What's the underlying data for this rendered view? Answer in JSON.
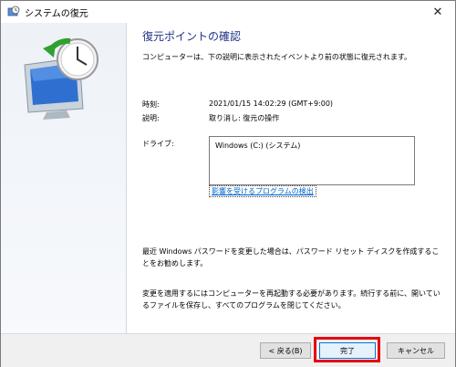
{
  "window": {
    "title": "システムの復元",
    "close_glyph": "✕"
  },
  "content": {
    "heading": "復元ポイントの確認",
    "intro": "コンピューターは、下の説明に表示されたイベントより前の状態に復元されます。",
    "time_label": "時刻:",
    "time_value": "2021/01/15 14:02:29 (GMT+9:00)",
    "desc_label": "説明:",
    "desc_value": "取り消し: 復元の操作",
    "drive_label": "ドライブ:",
    "drives": [
      "Windows (C:) (システム)"
    ],
    "link_affected": "影響を受けるプログラムの検出",
    "note_password": "最近 Windows パスワードを変更した場合は、パスワード リセット ディスクを作成することをお勧めします。",
    "note_restart": "変更を適用するにはコンピューターを再起動する必要があります。続行する前に、開いているファイルを保存し、すべてのプログラムを閉じてください。"
  },
  "footer": {
    "back_label": "< 戻る(B)",
    "finish_label": "完了",
    "cancel_label": "キャンセル"
  },
  "colors": {
    "heading": "#1e3287",
    "link": "#0066cc",
    "highlight": "#e60012"
  },
  "icons": {
    "title_icon": "system-restore-icon",
    "hero": "system-restore-hero-icon"
  }
}
